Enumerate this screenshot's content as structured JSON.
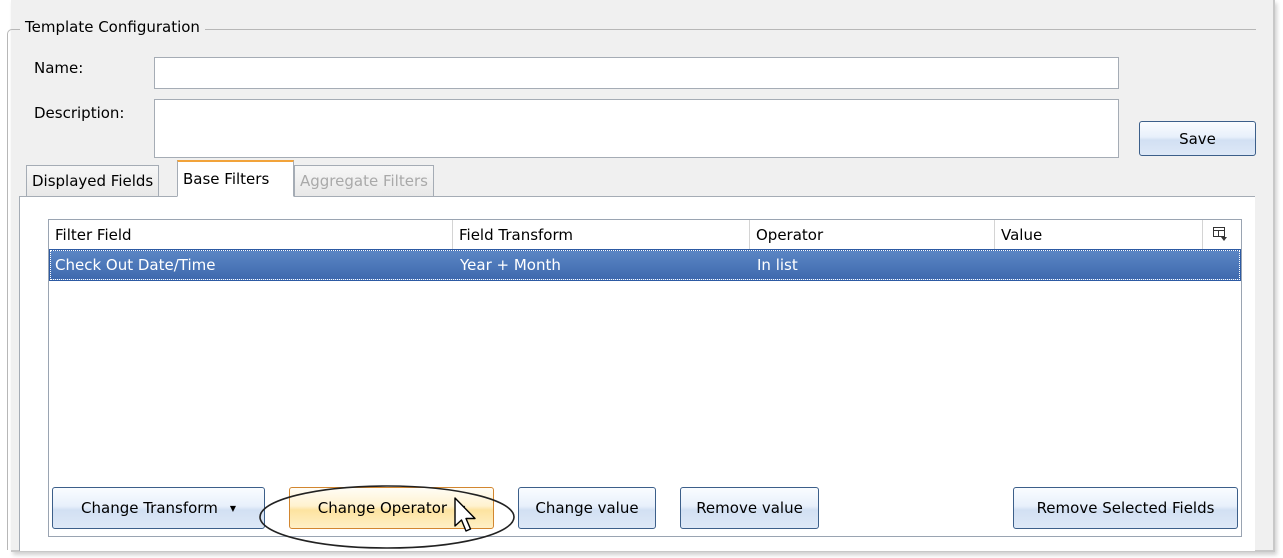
{
  "group": {
    "title": "Template Configuration"
  },
  "form": {
    "name_label": "Name:",
    "name_value": "",
    "description_label": "Description:",
    "description_value": "",
    "save_label": "Save"
  },
  "tabs": [
    {
      "label": "Displayed Fields",
      "state": "normal"
    },
    {
      "label": "Base Filters",
      "state": "active"
    },
    {
      "label": "Aggregate Filters",
      "state": "disabled"
    }
  ],
  "grid": {
    "columns": [
      "Filter Field",
      "Field Transform",
      "Operator",
      "Value"
    ],
    "rows": [
      {
        "filter_field": "Check Out Date/Time",
        "field_transform": "Year + Month",
        "operator": "In list",
        "value": "",
        "selected": true
      }
    ]
  },
  "buttons": {
    "change_transform": "Change Transform",
    "change_operator": "Change Operator",
    "change_value": "Change value",
    "remove_value": "Remove value",
    "remove_selected_fields": "Remove Selected Fields"
  },
  "colors": {
    "selection": "#4a76b8",
    "active_tab_accent": "#f2a33a",
    "button_border": "#3c5f8a",
    "hot_button_border": "#d2862f"
  }
}
